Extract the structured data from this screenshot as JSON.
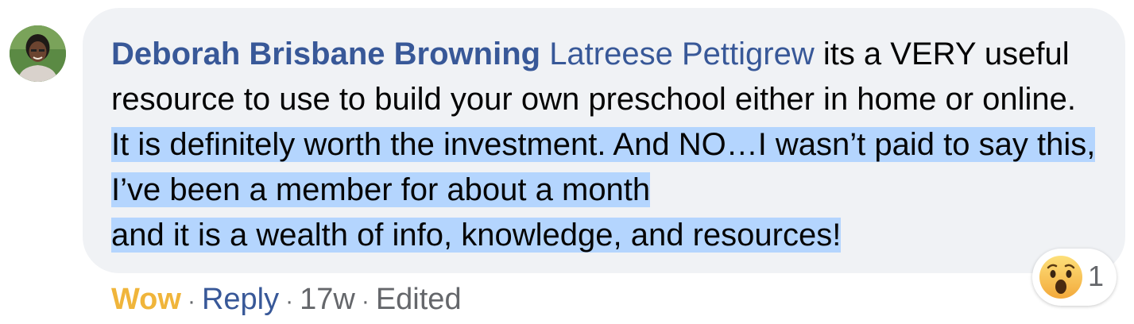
{
  "comment": {
    "author": "Deborah Brisbane Browning",
    "mention": "Latreese Pettigrew",
    "body_plain": " its a VERY useful resource to use to build your own preschool either in home or online. ",
    "body_highlighted_1": "It is definitely worth the investment. And NO…I wasn’t paid to say this, I’ve been a member for about a month",
    "body_highlighted_2": "and it is a wealth of info, knowledge, and resources!"
  },
  "actions": {
    "reaction_label": "Wow",
    "reply_label": "Reply",
    "time": "17w",
    "edited": "Edited",
    "separator": "·"
  },
  "reactions": {
    "icon": "wow-emoji-icon",
    "count": "1"
  },
  "colors": {
    "author": "#385898",
    "bubble": "#f0f2f5",
    "highlight": "#b4d5fe",
    "wow": "#f0b53b",
    "meta": "#65676b"
  }
}
